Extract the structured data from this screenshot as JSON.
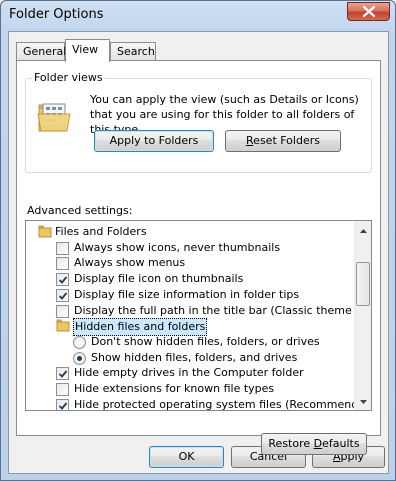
{
  "window": {
    "title": "Folder Options",
    "close_icon": "close-icon"
  },
  "tabs": [
    {
      "label": "General",
      "active": false
    },
    {
      "label": "View",
      "active": true
    },
    {
      "label": "Search",
      "active": false
    }
  ],
  "folder_views": {
    "legend": "Folder views",
    "description": "You can apply the view (such as Details or Icons) that you are using for this folder to all folders of this type.",
    "icon": "folder-view-icon",
    "apply_button": "Apply to Folders",
    "reset_button_access": "R",
    "reset_button_rest": "eset Folders"
  },
  "advanced": {
    "label": "Advanced settings:",
    "items": [
      {
        "type": "folder",
        "label": "Files and Folders",
        "indent": 0
      },
      {
        "type": "checkbox",
        "label": "Always show icons, never thumbnails",
        "checked": false
      },
      {
        "type": "checkbox",
        "label": "Always show menus",
        "checked": false
      },
      {
        "type": "checkbox",
        "label": "Display file icon on thumbnails",
        "checked": true
      },
      {
        "type": "checkbox",
        "label": "Display file size information in folder tips",
        "checked": true
      },
      {
        "type": "checkbox",
        "label": "Display the full path in the title bar (Classic theme only)",
        "checked": false
      },
      {
        "type": "folder",
        "label": "Hidden files and folders",
        "indent": 1,
        "selected": true
      },
      {
        "type": "radio",
        "label": "Don't show hidden files, folders, or drives",
        "checked": false
      },
      {
        "type": "radio",
        "label": "Show hidden files, folders, and drives",
        "checked": true
      },
      {
        "type": "checkbox",
        "label": "Hide empty drives in the Computer folder",
        "checked": true
      },
      {
        "type": "checkbox",
        "label": "Hide extensions for known file types",
        "checked": false
      },
      {
        "type": "checkbox",
        "label": "Hide protected operating system files (Recommended)",
        "checked": true
      }
    ]
  },
  "buttons": {
    "restore_prefix": "Restore ",
    "restore_access": "D",
    "restore_rest": "efaults",
    "ok": "OK",
    "cancel": "Cancel",
    "apply_access": "A",
    "apply_rest": "pply"
  },
  "colors": {
    "selection": "#cce8ff",
    "default_button_border": "#3c7fb1",
    "close_button": "#c0442b"
  }
}
